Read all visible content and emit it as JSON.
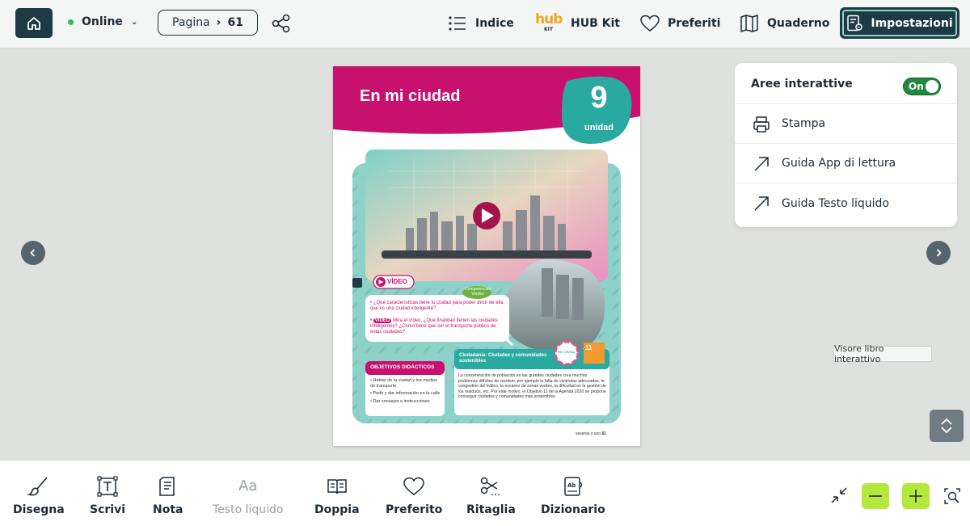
{
  "topbar": {
    "status": "Online",
    "page_label": "Pagina",
    "page_number": "61",
    "nav": {
      "index": "Indice",
      "hub_logo_text": "hub",
      "hub_logo_sub": "KIT",
      "hub_kit": "HUB Kit",
      "favorites": "Preferiti",
      "notebook": "Quaderno",
      "settings": "Impostazioni"
    }
  },
  "settings_menu": {
    "interactive_areas": "Aree interattive",
    "toggle_state": "On",
    "print": "Stampa",
    "app_guide": "Guida App di lettura",
    "liquid_guide": "Guida Testo liquido"
  },
  "tooltip": "Visore libro interattivo",
  "book_page": {
    "title": "En mi ciudad",
    "unit_number": "9",
    "unit_label": "unidad",
    "video_badge": "VÍDEO",
    "competencias": "Competencias Verdes",
    "question_1": "¿Qué características tiene tu ciudad para poder decir de ella que es una ciudad inteligente?",
    "question_2_badge": "VÍDEO",
    "question_2": "Mira el vídeo. ¿Qué finalidad tienen las ciudades inteligentes? ¿Cómo tiene que ser el transporte público de estas ciudades?",
    "objectives_title": "OBJETIVOS DIDÁCTICOS",
    "objectives": [
      "Hablar de la ciudad y los medios de transporte",
      "Pedir y dar información en la calle",
      "Dar consejos e instrucciones"
    ],
    "civics_title": "Ciudadanía: Ciudades y comunidades sostenibles",
    "civics_badge": "ED. CÍVICA",
    "sdg_number": "11",
    "civics_text": "La concentración de población en las grandes ciudades crea muchos problemas difíciles de resolver, por ejemplo la falta de viviendas adecuadas, la congestión del tráfico, la escasez de zonas verdes, la dificultad en la gestión de los residuos, etc. Por este motivo, el Objetivo 11 de la Agenda 2030 se propone conseguir ciudades y comunidades más sostenibles.",
    "footer": "sesenta y uno",
    "footer_num": "61"
  },
  "toolbar": {
    "draw": "Disegna",
    "write": "Scrivi",
    "note": "Nota",
    "liquid_text": "Testo liquido",
    "double": "Doppia",
    "favorite": "Preferito",
    "crop": "Ritaglia",
    "dictionary": "Dizionario"
  },
  "colors": {
    "dark_teal": "#1e3a45",
    "magenta": "#c8106e",
    "teal": "#2aa9a0",
    "lime": "#b5e83c",
    "online_green": "#2ec24a"
  }
}
